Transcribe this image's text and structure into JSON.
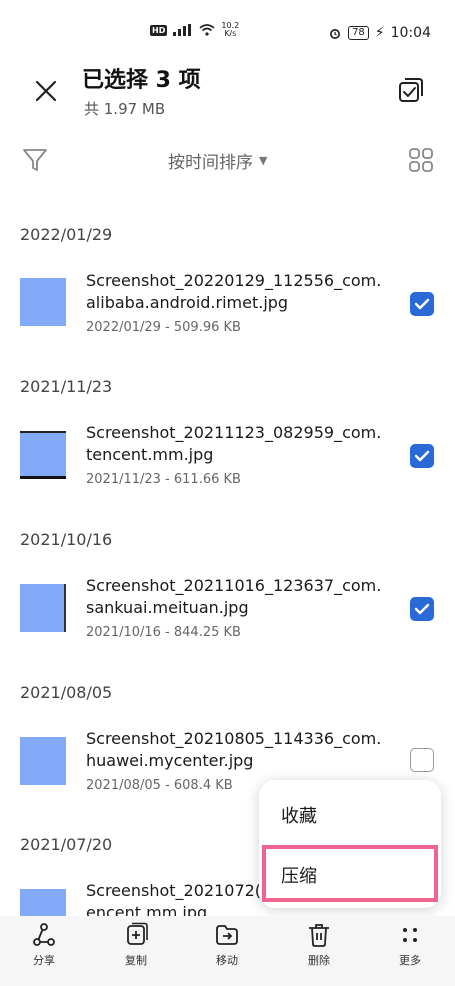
{
  "status_bar": {
    "speed": "10.2\nK/s",
    "battery": "78",
    "time": "10:04"
  },
  "header": {
    "title": "已选择 3 项",
    "subtitle": "共 1.97 MB"
  },
  "toolbar": {
    "sort_label": "按时间排序"
  },
  "groups": [
    {
      "date": "2022/01/29",
      "name": "Screenshot_20220129_112556_com.alibaba.android.rimet.jpg",
      "meta": "2022/01/29 - 509.96 KB",
      "checked": true
    },
    {
      "date": "2021/11/23",
      "name": "Screenshot_20211123_082959_com.tencent.mm.jpg",
      "meta": "2021/11/23 - 611.66 KB",
      "checked": true
    },
    {
      "date": "2021/10/16",
      "name": "Screenshot_20211016_123637_com.sankuai.meituan.jpg",
      "meta": "2021/10/16 - 844.25 KB",
      "checked": true
    },
    {
      "date": "2021/08/05",
      "name": "Screenshot_20210805_114336_com.huawei.mycenter.jpg",
      "meta": "2021/08/05 - 608.4 KB",
      "checked": false
    },
    {
      "date": "2021/07/20",
      "name": "Screenshot_2021072(\nencent.mm.jpg",
      "meta": "",
      "checked": false
    }
  ],
  "popup_menu": {
    "items": [
      {
        "label": "收藏"
      },
      {
        "label": "压缩"
      }
    ]
  },
  "bottom_bar": {
    "items": [
      {
        "label": "分享",
        "icon": "share-icon"
      },
      {
        "label": "复制",
        "icon": "copy-icon"
      },
      {
        "label": "移动",
        "icon": "move-icon"
      },
      {
        "label": "删除",
        "icon": "delete-icon"
      },
      {
        "label": "更多",
        "icon": "more-icon"
      }
    ]
  },
  "colors": {
    "accent": "#2a6ad7",
    "thumb": "#82aaf9",
    "highlight": "#f06590"
  }
}
